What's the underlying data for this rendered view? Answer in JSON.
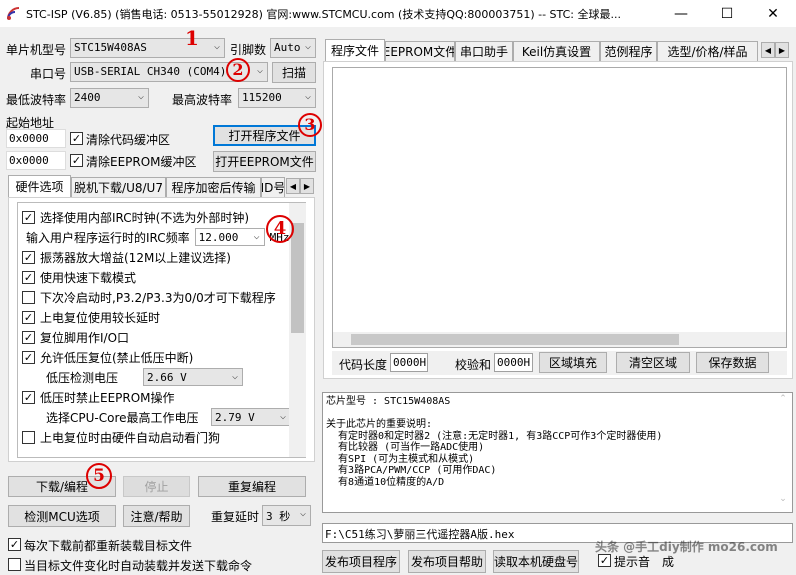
{
  "window": {
    "title": "STC-ISP (V6.85) (销售电话: 0513-55012928) 官网:www.STCMCU.com  (技术支持QQ:800003751)  -- STC: 全球最...",
    "minimize": "—",
    "maximize": "☐",
    "close": "✕"
  },
  "left": {
    "mcu_label": "单片机型号",
    "mcu_value": "STC15W408AS",
    "pins_label": "引脚数",
    "pins_value": "Auto",
    "port_label": "串口号",
    "port_value": "USB-SERIAL CH340 (COM4)",
    "scan": "扫描",
    "min_baud_label": "最低波特率",
    "min_baud": "2400",
    "max_baud_label": "最高波特率",
    "max_baud": "115200",
    "start_addr_label": "起始地址",
    "code_addr": "0x0000",
    "clear_code": "清除代码缓冲区",
    "open_program": "打开程序文件",
    "eeprom_addr": "0x0000",
    "clear_eeprom": "清除EEPROM缓冲区",
    "open_eeprom": "打开EEPROM文件",
    "tabs": [
      "硬件选项",
      "脱机下载/U8/U7",
      "程序加密后传输",
      "ID号"
    ],
    "options": [
      {
        "label": "选择使用内部IRC时钟(不选为外部时钟)",
        "checked": true
      },
      {
        "label": "振荡器放大增益(12M以上建议选择)",
        "checked": true
      },
      {
        "label": "使用快速下载模式",
        "checked": true
      },
      {
        "label": "下次冷启动时,P3.2/P3.3为0/0才可下载程序",
        "checked": false
      },
      {
        "label": "上电复位使用较长延时",
        "checked": true
      },
      {
        "label": "复位脚用作I/O口",
        "checked": true
      },
      {
        "label": "允许低压复位(禁止低压中断)",
        "checked": true
      },
      {
        "label": "低压时禁止EEPROM操作",
        "checked": true
      },
      {
        "label": "上电复位时由硬件自动启动看门狗",
        "checked": false
      }
    ],
    "irc_label": "输入用户程序运行时的IRC频率",
    "irc_value": "12.000",
    "irc_unit": "MHz",
    "lv_label": "低压检测电压",
    "lv_value": "2.66 V",
    "cpu_label": "选择CPU-Core最高工作电压",
    "cpu_value": "2.79 V",
    "download": "下载/编程",
    "stop": "停止",
    "repeat": "重复编程",
    "detect": "检测MCU选项",
    "help": "注意/帮助",
    "delay_label": "重复延时",
    "delay_value": "3 秒",
    "reload": "每次下载前都重新装载目标文件",
    "auto_send": "当目标文件变化时自动装载并发送下载命令"
  },
  "right": {
    "tabs": [
      "程序文件",
      "EEPROM文件",
      "串口助手",
      "Keil仿真设置",
      "范例程序",
      "选型/价格/样品"
    ],
    "code_len_label": "代码长度",
    "code_len": "0000H",
    "checksum_label": "校验和",
    "checksum": "0000H",
    "fill": "区域填充",
    "clear": "清空区域",
    "save": "保存数据",
    "info": [
      "芯片型号 : STC15W408AS",
      "",
      "关于此芯片的重要说明:",
      "  有定时器0和定时器2 (注意:无定时器1, 有3路CCP可作3个定时器使用)",
      "  有比较器 (可当作一路ADC使用)",
      "  有SPI (可为主模式和从模式)",
      "  有3路PCA/PWM/CCP (可用作DAC)",
      "  有8通道10位精度的A/D"
    ],
    "file_path": "F:\\C51练习\\萝丽三代遥控器A版.hex",
    "publish": "发布项目程序",
    "publish_help": "发布项目帮助",
    "read_disk": "读取本机硬盘号",
    "beep": "提示音",
    "success": "成"
  },
  "annotations": [
    "1",
    "2",
    "3",
    "4",
    "5"
  ],
  "watermark": "头条 @手工diy制作  mo26.com"
}
